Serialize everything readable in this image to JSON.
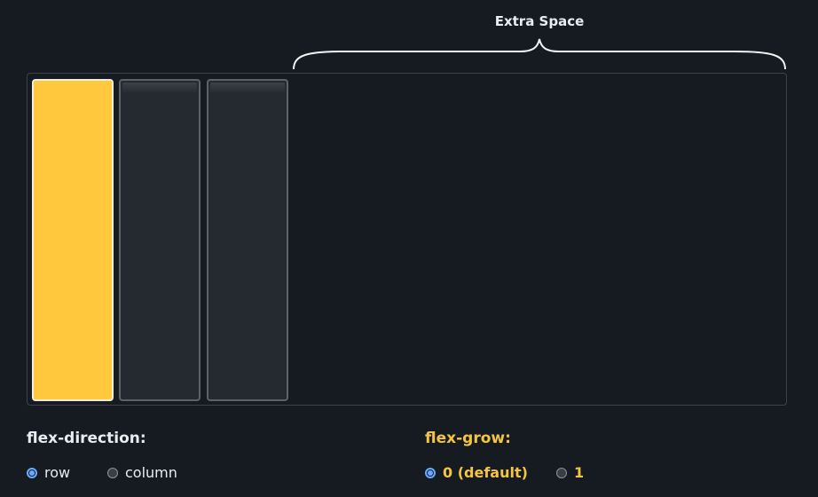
{
  "demo": {
    "extra_space_label": "Extra Space",
    "items_count": 3
  },
  "controls": {
    "flex_direction": {
      "title": "flex-direction:",
      "options": [
        "row",
        "column"
      ],
      "selected": "row"
    },
    "flex_grow": {
      "title": "flex-grow:",
      "options": [
        "0 (default)",
        "1"
      ],
      "selected": "0 (default)"
    }
  },
  "colors": {
    "background": "#161b21",
    "active_item": "#ffc83d",
    "idle_item": "#252a31",
    "accent_text": "#f4c542",
    "radio_selected": "#6aa9ff"
  }
}
